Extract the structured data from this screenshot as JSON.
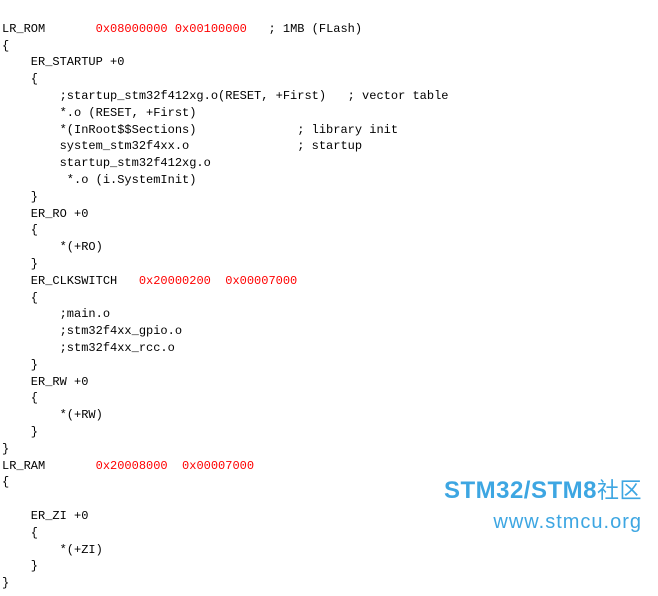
{
  "l1a": "LR_ROM       ",
  "l1b": "0x08000000",
  "l1c": " ",
  "l1d": "0x00100000",
  "l1e": "   ; 1MB (FLash)",
  "l2": "{",
  "l3": "    ER_STARTUP +0",
  "l4": "    {",
  "l5": "        ;startup_stm32f412xg.o(RESET, +First)   ; vector table",
  "l6": "        *.o (RESET, +First)",
  "l7": "        *(InRoot$$Sections)              ; library init",
  "l8": "        system_stm32f4xx.o               ; startup",
  "l9": "        startup_stm32f412xg.o",
  "l10": "         *.o (i.SystemInit)",
  "l11": "    }",
  "l12": "    ER_RO +0",
  "l13": "    {",
  "l14": "        *(+RO)",
  "l15": "    }",
  "l16a": "    ER_CLKSWITCH   ",
  "l16b": "0x20000200",
  "l16c": "  ",
  "l16d": "0x00007000",
  "l17": "    {",
  "l18": "        ;main.o",
  "l19": "        ;stm32f4xx_gpio.o",
  "l20": "        ;stm32f4xx_rcc.o",
  "l21": "    }",
  "l22": "    ER_RW +0",
  "l23": "    {",
  "l24": "        *(+RW)",
  "l25": "    }",
  "l26": "}",
  "l27a": "LR_RAM       ",
  "l27b": "0x20008000",
  "l27c": "  ",
  "l27d": "0x00007000",
  "l28": "{",
  "l29": "",
  "l30": "    ER_ZI +0",
  "l31": "    {",
  "l32": "        *(+ZI)",
  "l33": "    }",
  "l34": "}",
  "watermark": {
    "brand1": "STM32",
    "slash": "/",
    "brand2": "STM8",
    "cn": "社区",
    "url": "www.stmcu.org"
  }
}
